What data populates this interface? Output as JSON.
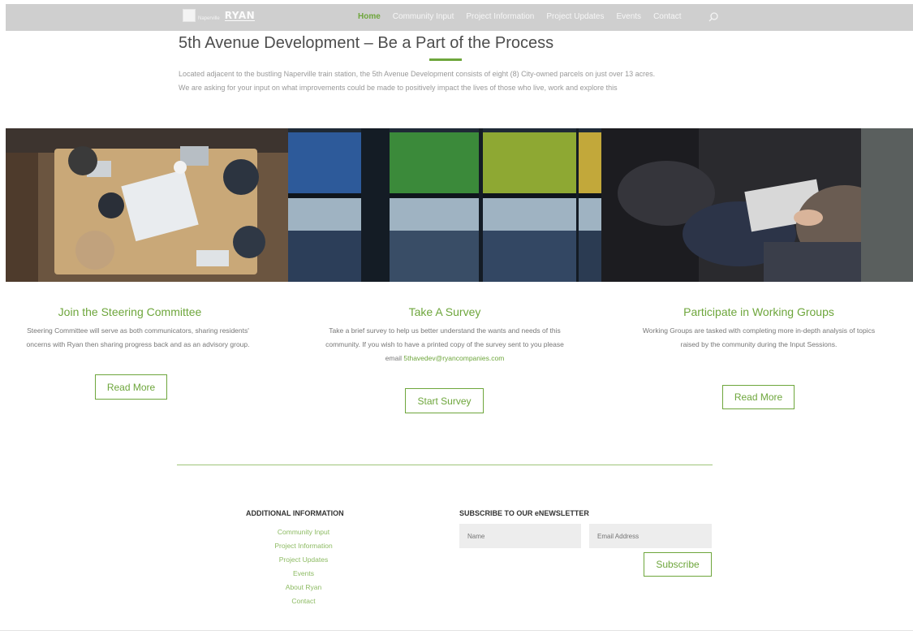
{
  "nav": {
    "logo_city_text": "Naperville",
    "logo_ryan": "RYAN",
    "items": [
      "Home",
      "Community Input",
      "Project Information",
      "Project Updates",
      "Events",
      "Contact"
    ],
    "active": "Home"
  },
  "hero": {
    "title": "5th Avenue Development – Be a Part of the Process",
    "line1": "Located adjacent to the bustling Naperville train station, the 5th Avenue Development consists of eight (8) City-owned parcels on just over 13 acres.",
    "line2": "We are asking for your input on what improvements could be made to positively impact the lives of those who live, work and explore this"
  },
  "columns": [
    {
      "title": "Join the Steering Committee",
      "text1": "Steering Committee will serve as both communicators, sharing residents'",
      "text2": "oncerns with Ryan then sharing progress back and as an advisory group.",
      "button": "Read More"
    },
    {
      "title": "Take A Survey",
      "text1": "Take a brief survey to help us better understand the wants and needs of this",
      "text2": "community. If you wish to have a printed copy of the survey sent to you please",
      "text3_prefix": "email",
      "email": "5thavedev@ryancompanies.com",
      "button": "Start Survey"
    },
    {
      "title": "Participate in Working Groups",
      "text1": "Working Groups are tasked with completing more in-depth analysis of topics",
      "text2": "raised by the community during the Input Sessions.",
      "button": "Read More"
    }
  ],
  "footer": {
    "additional_heading": "ADDITIONAL INFORMATION",
    "links": [
      "Community Input",
      "Project Information",
      "Project Updates",
      "Events",
      "About Ryan",
      "Contact"
    ],
    "newsletter_heading": "SUBSCRIBE TO OUR eNEWSLETTER",
    "name_placeholder": "Name",
    "email_placeholder": "Email Address",
    "subscribe": "Subscribe"
  },
  "colors": {
    "accent": "#6ea63c",
    "nav_bg": "#cfcfcf"
  }
}
